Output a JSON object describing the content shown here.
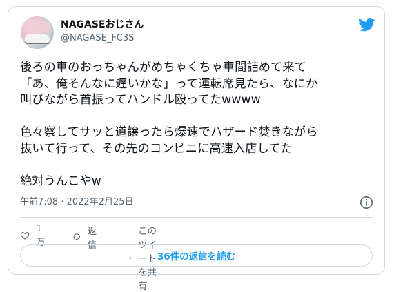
{
  "user": {
    "display_name": "NAGASEおじさん",
    "handle": "@NAGASE_FC3S"
  },
  "brand_icon": "twitter-bird-icon",
  "tweet": {
    "lines": [
      "後ろの車のおっちゃんがめちゃくちゃ車間詰めて来て",
      "「あ、俺そんなに遅いかな」って運転席見たら、なにか",
      "叫びながら首振ってハンドル殴ってたwwww",
      "",
      "色々察してサッと道譲ったら爆速でハザード焚きながら",
      "抜いて行って、その先のコンビニに高速入店してた",
      "",
      "絶対うんこやw"
    ],
    "timestamp": "午前7:08 · 2022年2月25日"
  },
  "actions": {
    "like_count": "1万",
    "reply_label": "返信",
    "share_label": "このツイートを共有"
  },
  "read_replies_label": "36件の返信を読む",
  "colors": {
    "accent": "#1d9bf0",
    "muted": "#536471",
    "border": "#cfd9de"
  }
}
